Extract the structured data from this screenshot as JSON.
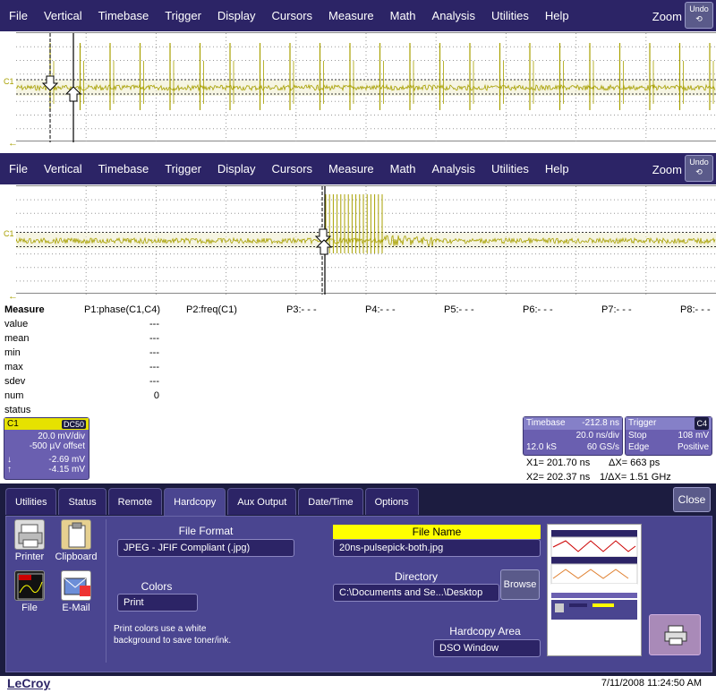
{
  "menubar": {
    "items": [
      "File",
      "Vertical",
      "Timebase",
      "Trigger",
      "Display",
      "Cursors",
      "Measure",
      "Math",
      "Analysis",
      "Utilities",
      "Help"
    ],
    "zoom_label": "Zoom",
    "undo_label": "Undo"
  },
  "trace": {
    "channel_label": "C1",
    "ground_marker": "←"
  },
  "measure": {
    "title": "Measure",
    "params": [
      "P1:phase(C1,C4)",
      "P2:freq(C1)",
      "P3:- - -",
      "P4:- - -",
      "P5:- - -",
      "P6:- - -",
      "P7:- - -",
      "P8:- - -"
    ],
    "rows": [
      "value",
      "mean",
      "min",
      "max",
      "sdev",
      "num",
      "status"
    ],
    "p1_values": [
      "---",
      "---",
      "---",
      "---",
      "---",
      "0",
      ""
    ]
  },
  "channel_box": {
    "name": "C1",
    "coupling": "DC50",
    "vdiv": "20.0 mV/div",
    "offset": "-500 µV offset",
    "down_val": "-2.69 mV",
    "up_val": "-4.15 mV"
  },
  "timebase_box": {
    "title": "Timebase",
    "delay": "-212.8 ns",
    "tdiv": "20.0 ns/div",
    "samples": "12.0 kS",
    "rate": "60 GS/s"
  },
  "trigger_box": {
    "title": "Trigger",
    "source": "C4",
    "mode": "Stop",
    "level": "108 mV",
    "type": "Edge",
    "slope": "Positive"
  },
  "cursor_readout": {
    "x1": "X1= 201.70 ns",
    "dx": "ΔX= 663 ps",
    "x2": "X2= 202.37 ns",
    "inv_dx": "1/ΔX= 1.51 GHz"
  },
  "dialog": {
    "tabs": [
      "Utilities",
      "Status",
      "Remote",
      "Hardcopy",
      "Aux Output",
      "Date/Time",
      "Options"
    ],
    "active_tab": "Hardcopy",
    "close_label": "Close",
    "devices": [
      "Printer",
      "Clipboard",
      "File",
      "E-Mail"
    ],
    "file_format_label": "File Format",
    "file_format_value": "JPEG - JFIF Compliant (.jpg)",
    "colors_label": "Colors",
    "colors_value": "Print",
    "colors_desc": "Print colors use a white background to save toner/ink.",
    "file_name_label": "File Name",
    "file_name_value": "20ns-pulsepick-both.jpg",
    "directory_label": "Directory",
    "directory_value": "C:\\Documents and Se...\\Desktop",
    "browse_label": "Browse",
    "hardcopy_area_label": "Hardcopy Area",
    "hardcopy_area_value": "DSO Window"
  },
  "footer": {
    "logo": "LeCroy",
    "datetime": "7/11/2008 11:24:50 AM"
  },
  "colors": {
    "menubar": "#2c2466",
    "trace": "#a8a000",
    "panel": "#4a4590",
    "highlight": "#ffff00"
  }
}
